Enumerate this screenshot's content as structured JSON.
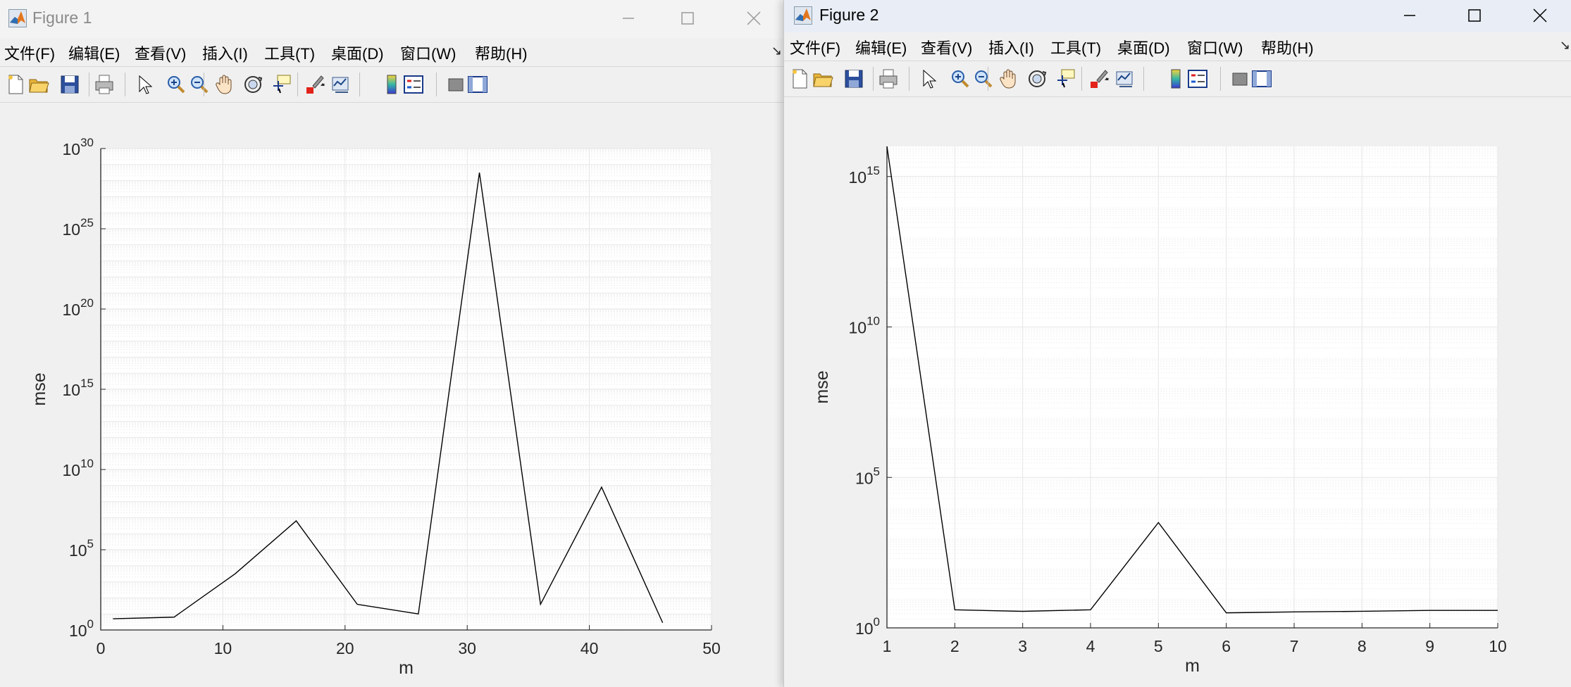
{
  "windows": [
    {
      "title": "Figure 1",
      "menu": [
        "文件(F)",
        "编辑(E)",
        "查看(V)",
        "插入(I)",
        "工具(T)",
        "桌面(D)",
        "窗口(W)",
        "帮助(H)"
      ]
    },
    {
      "title": "Figure 2",
      "menu": [
        "文件(F)",
        "编辑(E)",
        "查看(V)",
        "插入(I)",
        "工具(T)",
        "桌面(D)",
        "窗口(W)",
        "帮助(H)"
      ]
    }
  ],
  "toolbar_icons": [
    "new-figure-icon",
    "open-file-icon",
    "save-icon",
    "print-icon",
    "edit-plot-arrow-icon",
    "zoom-in-icon",
    "zoom-out-icon",
    "pan-hand-icon",
    "rotate-3d-icon",
    "data-cursor-icon",
    "brush-icon",
    "link-plot-icon",
    "colorbar-icon",
    "legend-icon",
    "hide-plot-tools-icon",
    "show-plot-tools-icon"
  ],
  "colors": {
    "line": "#000000",
    "grid": "#e6e6e6",
    "axes_bg": "#ffffff",
    "fig_bg": "#f0f0f0"
  },
  "chart_data": [
    {
      "type": "line",
      "xlabel": "m",
      "ylabel": "mse",
      "yscale": "log",
      "xlim": [
        0,
        50
      ],
      "ylim_exp": [
        0,
        30
      ],
      "xticks": [
        0,
        10,
        20,
        30,
        40,
        50
      ],
      "yticks_exp": [
        0,
        5,
        10,
        15,
        20,
        25,
        30
      ],
      "grid": true,
      "x": [
        1,
        6,
        11,
        16,
        21,
        26,
        31,
        36,
        41,
        46
      ],
      "y_exp": [
        0.7,
        0.8,
        3.5,
        6.8,
        1.6,
        1.0,
        28.5,
        1.6,
        8.9,
        0.45
      ]
    },
    {
      "type": "line",
      "xlabel": "m",
      "ylabel": "mse",
      "yscale": "log",
      "xlim": [
        1,
        10
      ],
      "ylim_exp": [
        0,
        16
      ],
      "xticks": [
        1,
        2,
        3,
        4,
        5,
        6,
        7,
        8,
        9,
        10
      ],
      "yticks_exp": [
        0,
        5,
        10,
        15
      ],
      "grid": true,
      "x": [
        1,
        2,
        3,
        4,
        5,
        6,
        7,
        8,
        9,
        10
      ],
      "y_exp": [
        16.0,
        0.6,
        0.55,
        0.6,
        3.5,
        0.5,
        0.53,
        0.55,
        0.58,
        0.58
      ]
    }
  ]
}
